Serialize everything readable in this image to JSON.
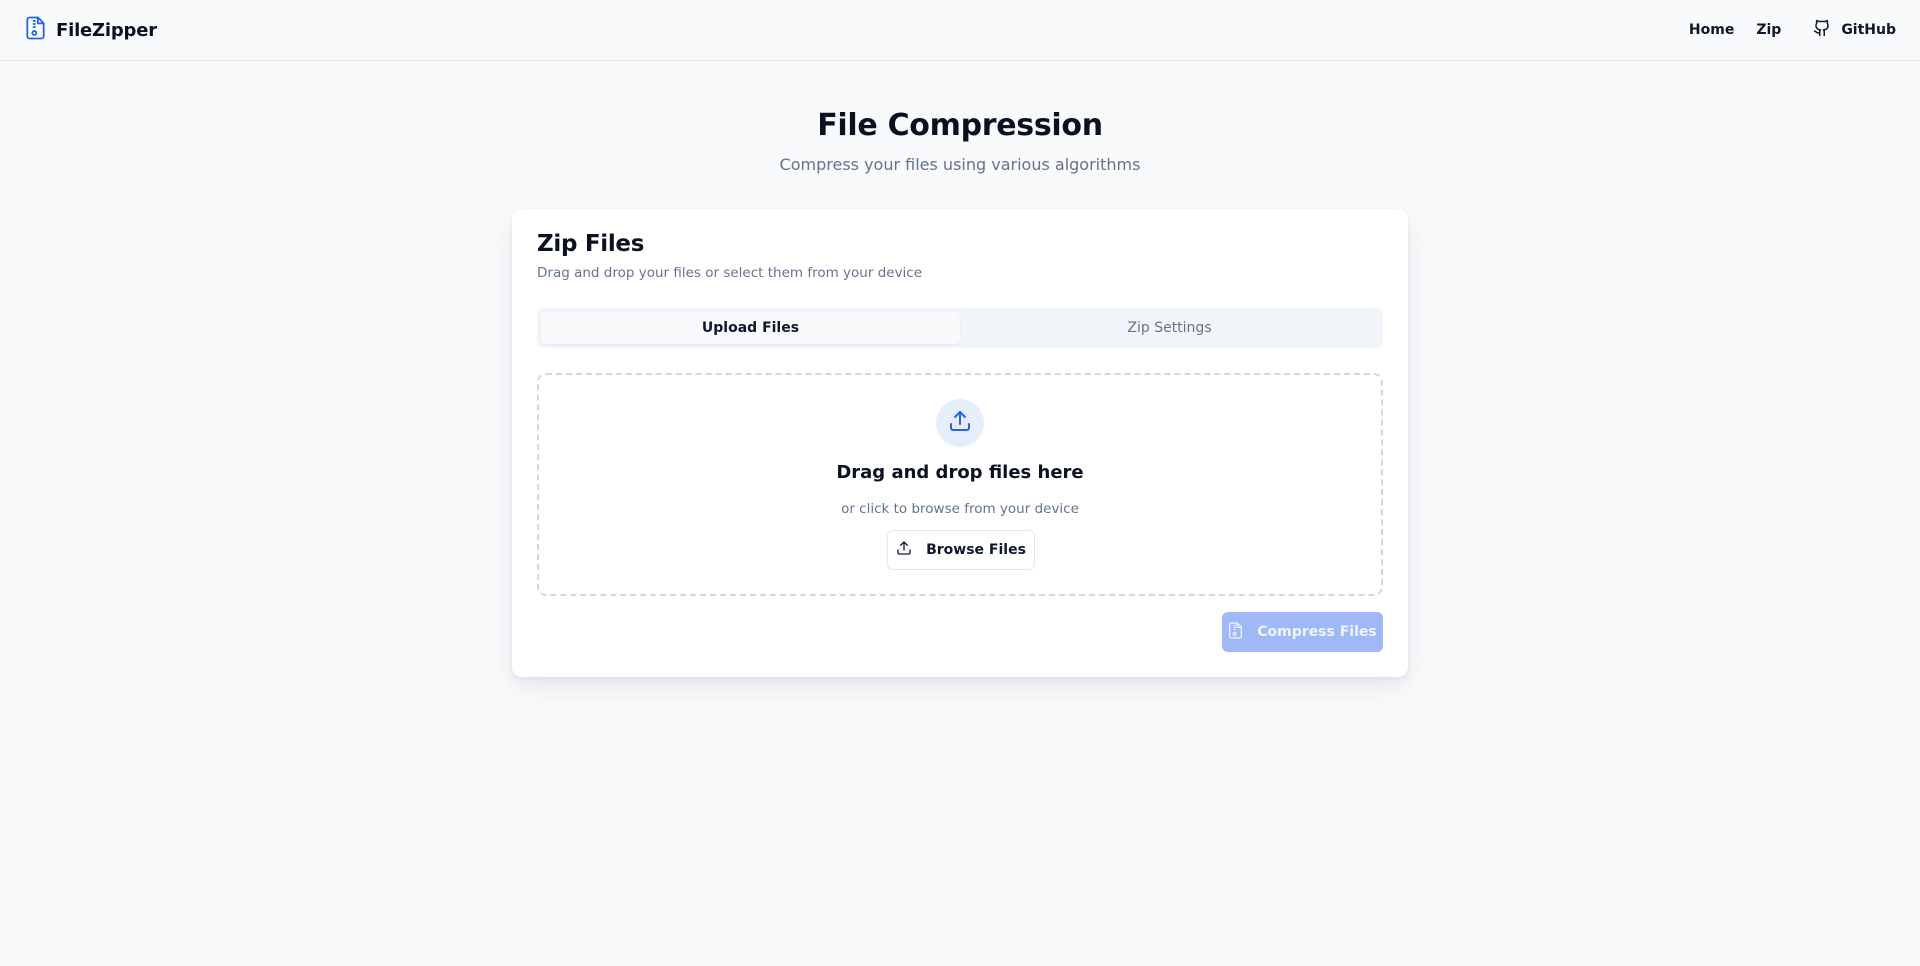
{
  "header": {
    "brand": "FileZipper",
    "nav": {
      "home": "Home",
      "zip": "Zip",
      "github": "GitHub"
    }
  },
  "hero": {
    "title": "File Compression",
    "subtitle": "Compress your files using various algorithms"
  },
  "card": {
    "title": "Zip Files",
    "subtitle": "Drag and drop your files or select them from your device",
    "tabs": [
      {
        "label": "Upload Files",
        "active": true
      },
      {
        "label": "Zip Settings",
        "active": false
      }
    ],
    "dropzone": {
      "title": "Drag and drop files here",
      "subtitle": "or click to browse from your device",
      "browse_label": "Browse Files"
    },
    "compress_label": "Compress Files",
    "compress_disabled": true
  },
  "icons": {
    "brand": "file-archive-icon",
    "github": "github-icon",
    "upload_circle": "upload-icon",
    "browse": "upload-icon",
    "compress": "file-archive-icon"
  },
  "colors": {
    "accent": "#2563eb",
    "background": "#f8fafc",
    "muted_text": "#64748b",
    "compress_disabled_bg": "#9fb8f6"
  }
}
